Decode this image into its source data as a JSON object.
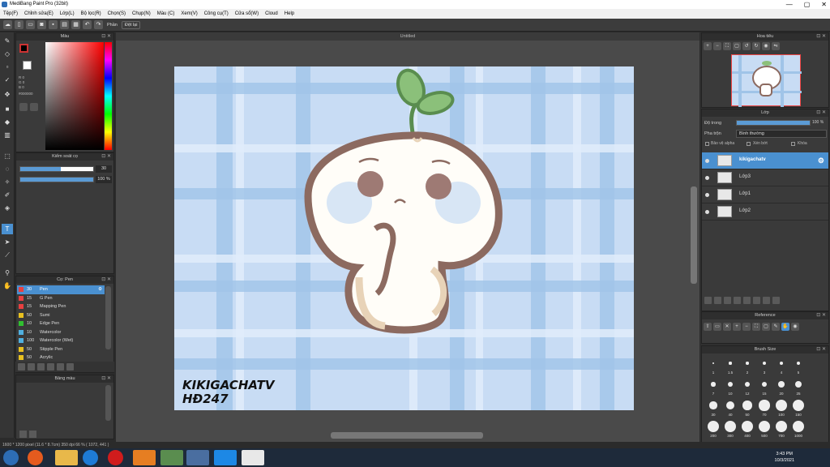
{
  "window": {
    "title": "MediBang Paint Pro (32bit)",
    "controls": [
      "—",
      "▢",
      "✕"
    ]
  },
  "menu": [
    "Tệp(F)",
    "Chỉnh sửa(E)",
    "Lớp(L)",
    "Bộ lọc(R)",
    "Chọn(S)",
    "Chụp(N)",
    "Màu (C)",
    "Xem(V)",
    "Công cụ(T)",
    "Cửa sổ(W)",
    "Cloud",
    "Help"
  ],
  "toolbar": {
    "prefix_label": "Phần",
    "mode_label": "Đệt lại"
  },
  "color_panel": {
    "title": "Màu",
    "info_lines": [
      "R 0",
      "G 0",
      "B 0",
      "#000000"
    ]
  },
  "brush_panel": {
    "title": "Kiểm soát cọ",
    "size_value": "30",
    "size_fraction": 0.55,
    "opacity_value": "100 %",
    "opacity_fraction": 1.0
  },
  "tool_panel": {
    "title": "Cọ: Pen",
    "brushes": [
      {
        "size": "30",
        "name": "Pen",
        "color": "#e84040",
        "selected": true
      },
      {
        "size": "15",
        "name": "G Pen",
        "color": "#e84040"
      },
      {
        "size": "15",
        "name": "Mapping Pen",
        "color": "#e84040"
      },
      {
        "size": "50",
        "name": "Sumi",
        "color": "#e8c020"
      },
      {
        "size": "10",
        "name": "Edge Pen",
        "color": "#30c030"
      },
      {
        "size": "10",
        "name": "Watercolor",
        "color": "#50b0e0"
      },
      {
        "size": "100",
        "name": "Watercolor (Wet)",
        "color": "#50b0e0"
      },
      {
        "size": "50",
        "name": "Stipple Pen",
        "color": "#e8c020"
      },
      {
        "size": "50",
        "name": "Acrylic",
        "color": "#e8c020"
      }
    ]
  },
  "palette_panel": {
    "title": "Bảng màu"
  },
  "document": {
    "title": "Untitled"
  },
  "artwork": {
    "signature_line1": "KIKIGACHATV",
    "signature_line2": "HĐ247"
  },
  "navigator": {
    "title": "Hoa tiêu"
  },
  "layer_panel": {
    "title": "Lớp",
    "opacity_label": "Độ trong",
    "opacity_value": "100 %",
    "blend_label": "Pha trộn",
    "blend_value": "Bình thường",
    "protect_alpha": "Bảo vệ alpha",
    "clipping": "Xén bớt",
    "lock": "Khóa",
    "layers": [
      {
        "name": "kikigachatv",
        "selected": true
      },
      {
        "name": "Lớp3"
      },
      {
        "name": "Lớp1"
      },
      {
        "name": "Lớp2"
      }
    ]
  },
  "reference_panel": {
    "title": "Reference"
  },
  "brush_size_panel": {
    "title": "Brush Size",
    "sizes": [
      "1",
      "1.5",
      "2",
      "3",
      "4",
      "5",
      "7",
      "10",
      "12",
      "15",
      "20",
      "25",
      "30",
      "40",
      "50",
      "70",
      "100",
      "150",
      "200",
      "300",
      "400",
      "500",
      "700",
      "1000"
    ]
  },
  "status": {
    "text": "1600 * 1200 pixel  (11.6 * 8.7cm)  350 dpi  66 %  ( 1072, 441 )"
  },
  "taskbar": {
    "time": "3:43 PM",
    "date": "10/3/2021"
  },
  "colors": {
    "accent": "#4a90d0",
    "canvas_bg": "#c8dcf4",
    "panel_bg": "#3a3a3a"
  }
}
